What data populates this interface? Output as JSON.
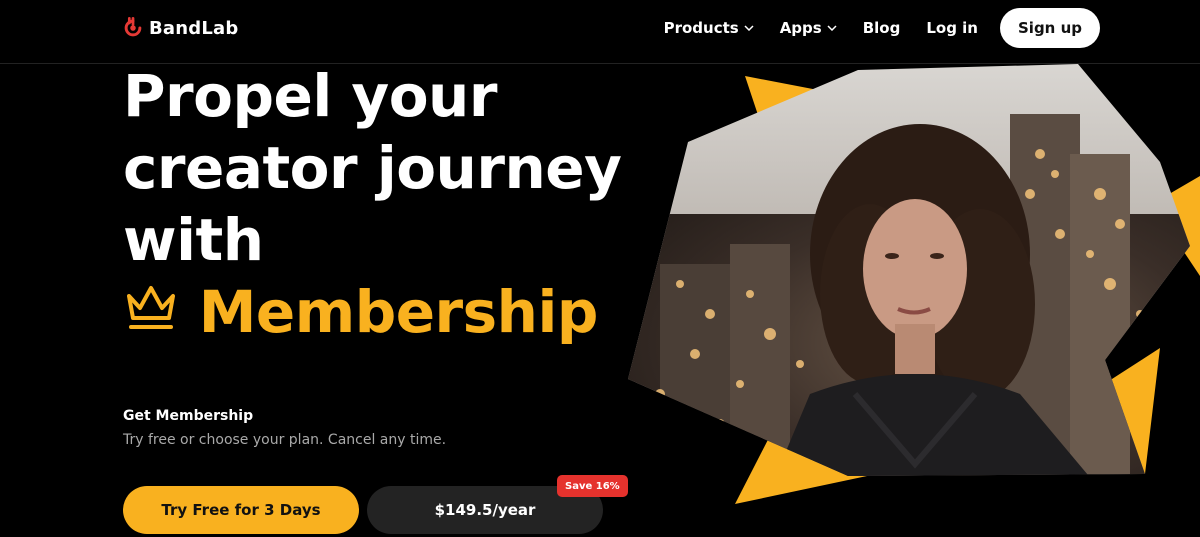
{
  "brand": {
    "name": "BandLab"
  },
  "nav": {
    "items": [
      {
        "label": "Products",
        "has_dropdown": true
      },
      {
        "label": "Apps",
        "has_dropdown": true
      },
      {
        "label": "Blog",
        "has_dropdown": false
      },
      {
        "label": "Log in",
        "has_dropdown": false
      }
    ],
    "signup_label": "Sign up"
  },
  "hero": {
    "headline_lines": [
      "Propel your",
      "creator journey",
      "with"
    ],
    "highlight": "Membership",
    "get_title": "Get Membership",
    "get_subtitle": "Try free or choose your plan. Cancel any time.",
    "try_button": "Try Free for 3 Days",
    "price_button": "$149.5/year",
    "save_badge": "Save 16%"
  },
  "icons": {
    "logo": "bandlab-logo-icon",
    "crown": "crown-icon",
    "dropdown": "chevron-down-icon"
  },
  "colors": {
    "accent": "#f9b11f",
    "background": "#000000",
    "badge": "#e5322d",
    "logo": "#e53935"
  }
}
